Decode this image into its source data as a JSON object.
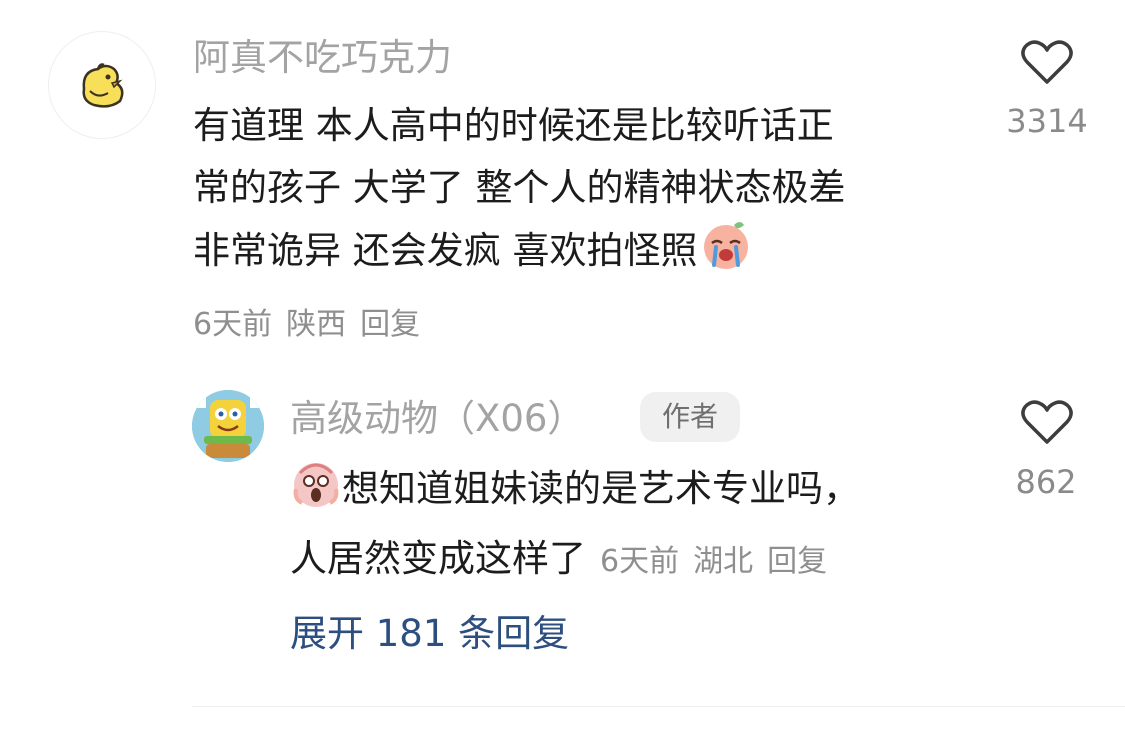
{
  "comment": {
    "username": "阿真不吃巧克力",
    "lines": [
      "有道理 本人高中的时候还是比较听话正",
      "常的孩子 大学了 整个人的精神状态极差",
      "非常诡异 还会发疯 喜欢拍怪照"
    ],
    "time": "6天前",
    "location": "陕西",
    "reply_label": "回复",
    "like_count": "3314",
    "avatar_icon": "yellow-chick-icon",
    "emoji_icon": "crying-face-emoji"
  },
  "reply": {
    "username": "高级动物（X06）",
    "author_badge": "作者",
    "lines": [
      "想知道姐妹读的是艺术专业吗，",
      "人居然变成这样了"
    ],
    "time": "6天前",
    "location": "湖北",
    "reply_label": "回复",
    "like_count": "862",
    "avatar_icon": "cartoon-character-avatar",
    "emoji_icon": "screaming-face-emoji"
  },
  "expand_replies_label": "展开 181 条回复",
  "colors": {
    "username": "#a3a3a3",
    "content": "#1c1c1c",
    "meta": "#8f8f8f",
    "expand_link": "#2d4f7f",
    "badge_bg": "#f0f0f0"
  }
}
